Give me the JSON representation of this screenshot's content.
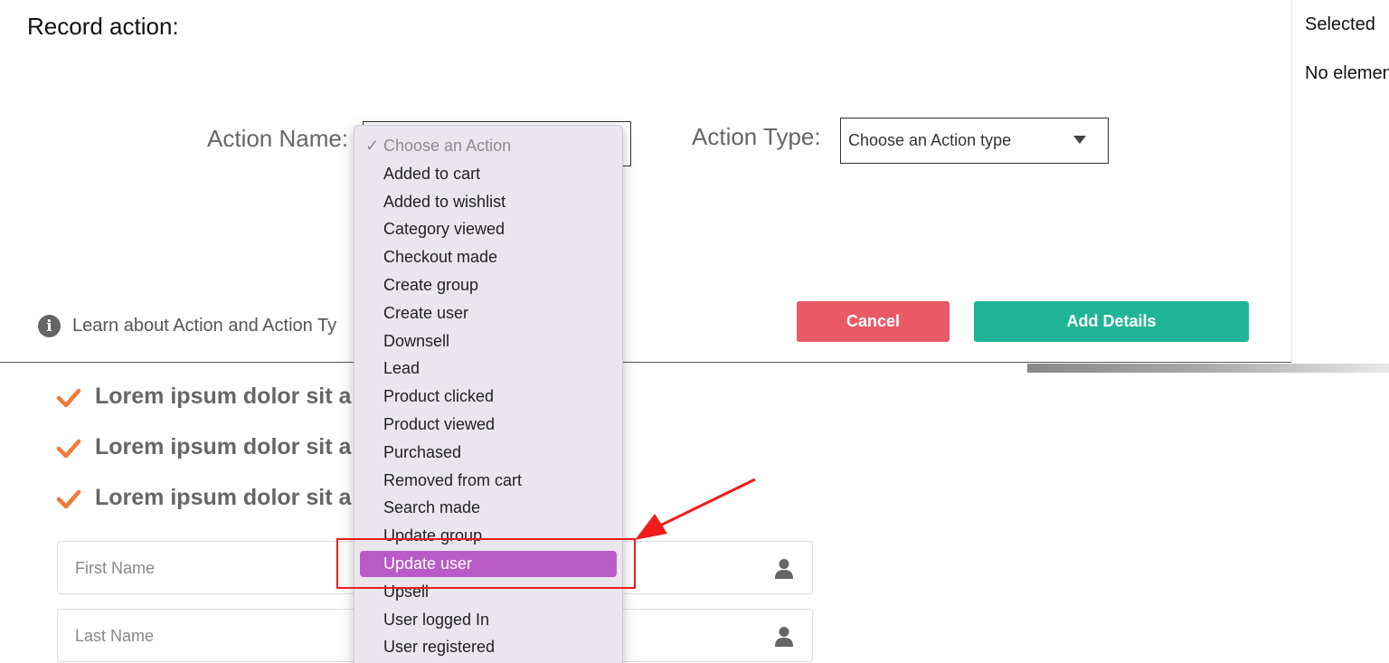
{
  "modal": {
    "title": "Record action:",
    "action_name_label": "Action Name:",
    "action_type_label": "Action Type:",
    "action_type_placeholder": "Choose an Action type",
    "info_text": "Learn about Action and Action Ty",
    "cancel_label": "Cancel",
    "add_details_label": "Add Details"
  },
  "side_panel": {
    "title": "Selected",
    "empty_text": "No elemen"
  },
  "page": {
    "bullets": [
      "Lorem ipsum dolor sit a",
      "Lorem ipsum dolor sit a",
      "Lorem ipsum dolor sit a"
    ],
    "first_name_placeholder": "First Name",
    "last_name_placeholder": "Last Name"
  },
  "dropdown": {
    "tick": "✓",
    "placeholder": "Choose an Action",
    "items": [
      "Added to cart",
      "Added to wishlist",
      "Category viewed",
      "Checkout made",
      "Create group",
      "Create user",
      "Downsell",
      "Lead",
      "Product clicked",
      "Product viewed",
      "Purchased",
      "Removed from cart",
      "Search made",
      "Update group",
      "Update user",
      "Upsell",
      "User logged In",
      "User registered"
    ],
    "selected_index": 14
  },
  "colors": {
    "cancel": "#e95a66",
    "add_details": "#1fb596",
    "highlight": "#b95bc6",
    "check": "#ee7a3c",
    "annotation": "#ee1c1c"
  }
}
